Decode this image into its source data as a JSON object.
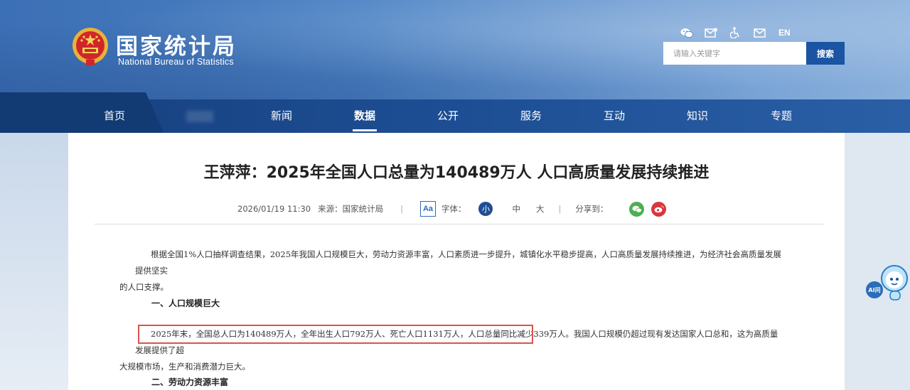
{
  "header": {
    "title_cn": "国家统计局",
    "title_en": "National Bureau of Statistics",
    "search_placeholder": "请输入关键字",
    "search_button": "搜索",
    "lang": "EN",
    "tool_icons": [
      "wechat-icon",
      "mail-edit-icon",
      "accessibility-icon",
      "mail-icon"
    ]
  },
  "nav": {
    "items": [
      "首页",
      "新闻",
      "数据",
      "公开",
      "服务",
      "互动",
      "知识",
      "专题"
    ],
    "active": "数据"
  },
  "article": {
    "title": "王萍萍：2025年全国人口总量为140489万人 人口高质量发展持续推进",
    "date": "2026/01/19 11:30",
    "source": "来源：国家统计局",
    "font_label": "字体：",
    "font_sizes": [
      "小",
      "中",
      "大"
    ],
    "share_label": "分享到：",
    "intro_line1": "根据全国1%人口抽样调查结果，2025年我国人口规模巨大，劳动力资源丰富，人口素质进一步提升，城镇化水平稳步提高，人口高质量发展持续推进，为经济社会高质量发展提供坚实",
    "intro_line2": "的人口支撑。",
    "heading1": "一、人口规模巨大",
    "para1_highlight": "2025年末，全国总人口为140489万人，全年出生人口792万人、死亡人口1131万人，人口总量同比减少339万人。",
    "para1_rest": "我国人口规模仍超过现有发达国家人口总和，这为高质量发展提供了超",
    "para1_line2": "大规模市场，生产和消费潜力巨大。",
    "heading2": "二、劳动力资源丰富"
  },
  "widget": {
    "label": "AI问"
  },
  "colors": {
    "nav_bg": "#1d4e94",
    "header_bg": "#4b82c4",
    "highlight_border": "#d9534f"
  }
}
